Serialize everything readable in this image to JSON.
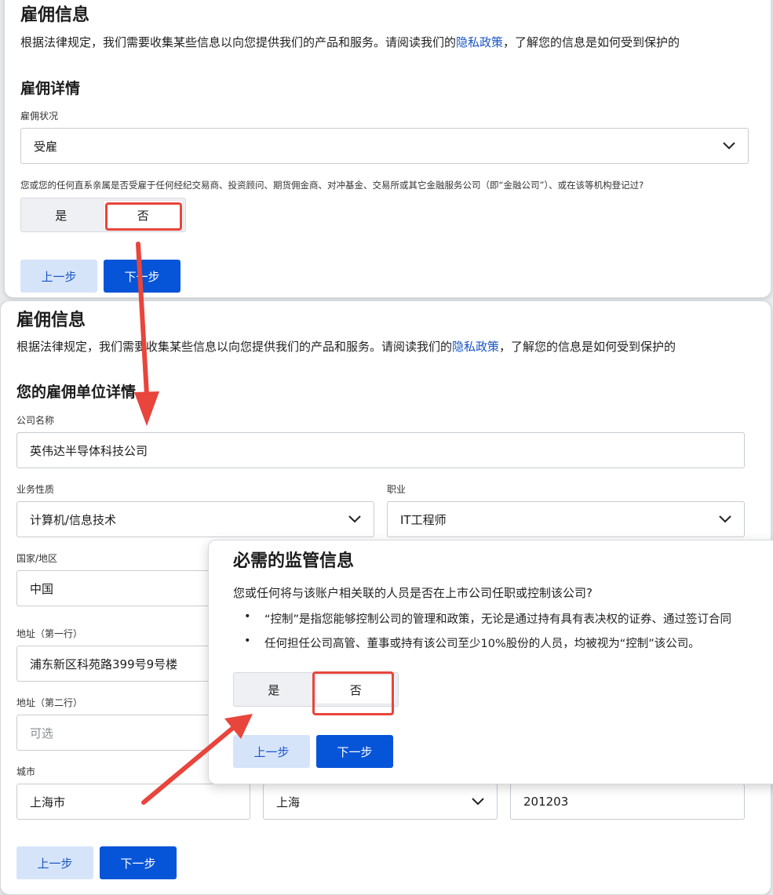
{
  "colors": {
    "accent": "#0654d8",
    "link": "#1a56c4",
    "annotation_red": "#e8453c"
  },
  "panel1": {
    "title": "雇佣信息",
    "intro_before": "根据法律规定，我们需要收集某些信息以向您提供我们的产品和服务。请阅读我们的",
    "intro_link": "隐私政策",
    "intro_after": "，了解您的信息是如何受到保护的",
    "section_title": "雇佣详情",
    "status_label": "雇佣状况",
    "status_value": "受雇",
    "question": "您或您的任何直系亲属是否受雇于任何经纪交易商、投资顾问、期货佣金商、对冲基金、交易所或其它金融服务公司（即“金融公司”）、或在该等机构登记过?",
    "yes": "是",
    "no": "否",
    "prev": "上一步",
    "next": "下一步"
  },
  "panel2": {
    "title": "雇佣信息",
    "intro_before": "根据法律规定，我们需要收集某些信息以向您提供我们的产品和服务。请阅读我们的",
    "intro_link": "隐私政策",
    "intro_after": "，了解您的信息是如何受到保护的",
    "section_title": "您的雇佣单位详情",
    "company_label": "公司名称",
    "company_value": "英伟达半导体科技公司",
    "business_label": "业务性质",
    "business_value": "计算机/信息技术",
    "occupation_label": "职业",
    "occupation_value": "IT工程师",
    "country_label": "国家/地区",
    "country_value": "中国",
    "address1_label": "地址（第一行）",
    "address1_value": "浦东新区科苑路399号9号楼",
    "address2_label": "地址（第二行）",
    "address2_placeholder": "可选",
    "city_label": "城市",
    "city_value": "上海市",
    "province_value": "上海",
    "postal_value": "201203",
    "prev": "上一步",
    "next": "下一步"
  },
  "panel3": {
    "title": "必需的监管信息",
    "question": "您或任何将与该账户相关联的人员是否在上市公司任职或控制该公司?",
    "bullet1": "“控制”是指您能够控制公司的管理和政策，无论是通过持有具有表决权的证券、通过签订合同",
    "bullet2": "任何担任公司高管、董事或持有该公司至少10%股份的人员，均被视为“控制”该公司。",
    "yes": "是",
    "no": "否",
    "prev": "上一步",
    "next": "下一步"
  }
}
